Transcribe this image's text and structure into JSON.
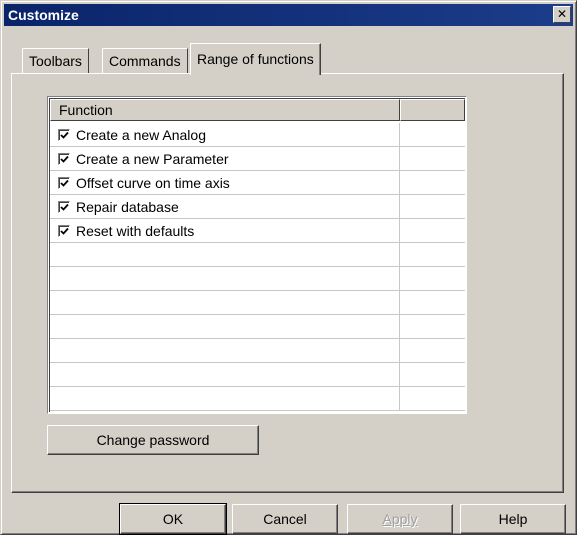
{
  "window": {
    "title": "Customize",
    "close_glyph": "✕"
  },
  "tabs": [
    {
      "label": "Toolbars",
      "active": false
    },
    {
      "label": "Commands",
      "active": false
    },
    {
      "label": "Range of functions",
      "active": true
    }
  ],
  "table": {
    "columns": [
      "Function",
      ""
    ],
    "rows": [
      {
        "label": "Create a new Analog",
        "checked": true
      },
      {
        "label": "Create a new Parameter",
        "checked": true
      },
      {
        "label": "Offset curve on time axis",
        "checked": true
      },
      {
        "label": "Repair database",
        "checked": true
      },
      {
        "label": "Reset with defaults",
        "checked": true
      },
      {
        "label": "",
        "checked": false
      },
      {
        "label": "",
        "checked": false
      },
      {
        "label": "",
        "checked": false
      },
      {
        "label": "",
        "checked": false
      },
      {
        "label": "",
        "checked": false
      },
      {
        "label": "",
        "checked": false
      },
      {
        "label": "",
        "checked": false
      }
    ]
  },
  "change_password_label": "Change password",
  "footer": {
    "ok_label": "OK",
    "cancel_label": "Cancel",
    "apply_label": "Apply",
    "help_label": "Help"
  },
  "icons": {
    "checkmark": "checkmark-icon",
    "close": "close-icon"
  },
  "colors": {
    "titlebar": "#0a246a",
    "face": "#d4d0c8"
  }
}
